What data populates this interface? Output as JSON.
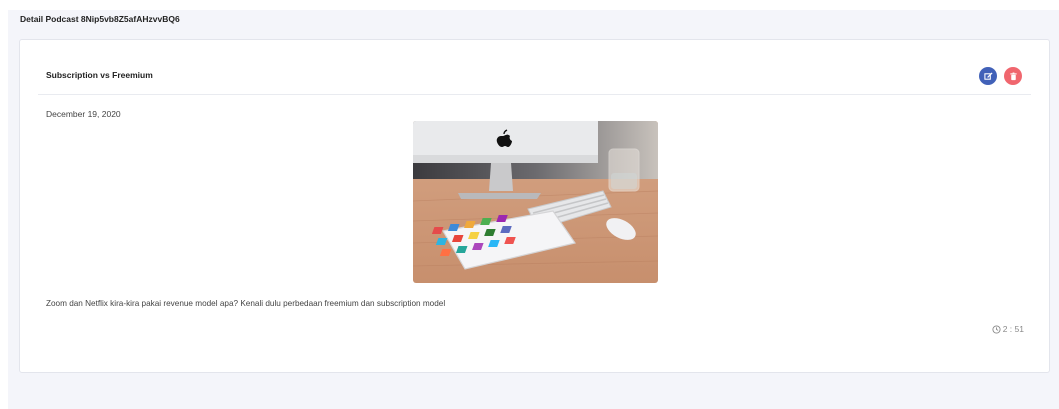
{
  "page": {
    "title": "Detail Podcast 8Nip5vb8Z5afAHzvvBQ6"
  },
  "card": {
    "title": "Subscription vs Freemium",
    "date": "December 19, 2020",
    "description": "Zoom dan Netflix kira-kira pakai revenue model apa? Kenali dulu perbedaan freemium dan subscription model",
    "duration": "2 : 51"
  },
  "actions": {
    "edit_icon": "edit-icon",
    "delete_icon": "trash-icon"
  },
  "colors": {
    "page_bg": "#f4f5fa",
    "edit_button": "#4161b8",
    "delete_button": "#f0666e"
  }
}
